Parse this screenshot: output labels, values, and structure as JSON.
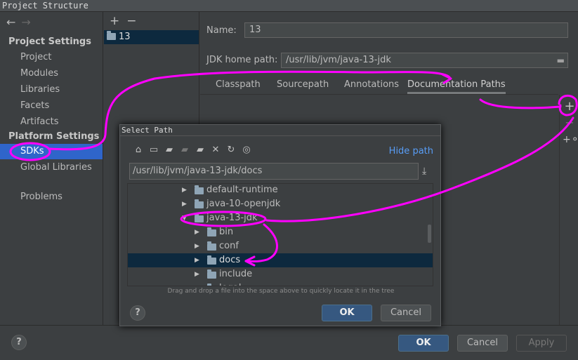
{
  "window": {
    "title": "Project Structure"
  },
  "nav": {
    "back_icon": "back-arrow-icon",
    "forward_icon": "forward-arrow-icon",
    "project_settings_heading": "Project Settings",
    "project_items": [
      "Project",
      "Modules",
      "Libraries",
      "Facets",
      "Artifacts"
    ],
    "platform_settings_heading": "Platform Settings",
    "platform_items": [
      "SDKs",
      "Global Libraries"
    ],
    "problems": "Problems",
    "selected": "SDKs"
  },
  "sdk_list": {
    "add_icon": "+",
    "remove_icon": "−",
    "items": [
      "13"
    ]
  },
  "sdk_detail": {
    "name_label": "Name:",
    "name_value": "13",
    "jdk_home_label": "JDK home path:",
    "jdk_home_value": "/usr/lib/jvm/java-13-jdk",
    "tabs": [
      "Classpath",
      "Sourcepath",
      "Annotations",
      "Documentation Paths"
    ],
    "active_tab": "Documentation Paths"
  },
  "select_path_dialog": {
    "title": "Select Path",
    "hide_path": "Hide path",
    "path_value": "/usr/lib/jvm/java-13-jdk/docs",
    "tree": [
      {
        "label": "default-runtime",
        "expanded": false
      },
      {
        "label": "java-10-openjdk",
        "expanded": false
      },
      {
        "label": "java-13-jdk",
        "expanded": true
      },
      {
        "label": "bin",
        "expanded": false
      },
      {
        "label": "conf",
        "expanded": false
      },
      {
        "label": "docs",
        "expanded": false,
        "selected": true
      },
      {
        "label": "include",
        "expanded": false
      },
      {
        "label": "legal",
        "expanded": false
      }
    ],
    "hint": "Drag and drop a file into the space above to quickly locate it in the tree",
    "help": "?",
    "ok": "OK",
    "cancel": "Cancel"
  },
  "footer": {
    "help": "?",
    "ok": "OK",
    "cancel": "Cancel",
    "apply": "Apply"
  },
  "colors": {
    "background": "#3c3f41",
    "selection": "#2f65ca",
    "tree_selection": "#0d293e",
    "primary_button": "#365880",
    "link": "#589df6",
    "annotation": "#ff00ff"
  }
}
